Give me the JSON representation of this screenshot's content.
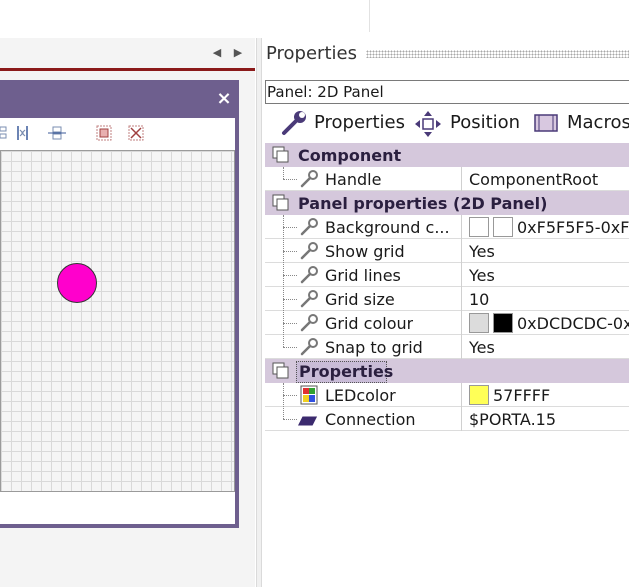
{
  "colors": {
    "window_purple": "#6e5f8e",
    "category_bg": "#d5c8dc",
    "led": "#ff00cc",
    "accent_red": "#8b1a1a"
  },
  "icons": {
    "tab_nav": [
      "chevron-left-icon",
      "chevron-right-icon"
    ],
    "toolbar": [
      "align-icon",
      "distribute-icon",
      "group-icon",
      "select-all-icon",
      "ungroup-icon"
    ],
    "property": "wrench-icon",
    "category": "copy-stack-icon"
  },
  "panel_window": {
    "close_glyph": "×"
  },
  "properties_panel": {
    "title": "Properties",
    "selector_value": "Panel: 2D Panel",
    "subtabs": [
      {
        "label": "Properties"
      },
      {
        "label": "Position"
      },
      {
        "label": "Macros"
      }
    ],
    "categories": [
      {
        "title": "Component",
        "rows": [
          {
            "label": "Handle",
            "value": "ComponentRoot"
          }
        ]
      },
      {
        "title": "Panel properties (2D Panel)",
        "rows": [
          {
            "label": "Background c...",
            "value": "0xF5F5F5-0xF",
            "swatch1": "#f5f5f5",
            "swatch2": "#ffffff"
          },
          {
            "label": "Show grid",
            "value": "Yes"
          },
          {
            "label": "Grid lines",
            "value": "Yes"
          },
          {
            "label": "Grid size",
            "value": "10"
          },
          {
            "label": "Grid colour",
            "value": "0xDCDCDC-0x",
            "swatch1": "#dcdcdc",
            "swatch2": "#000000"
          },
          {
            "label": "Snap to grid",
            "value": "Yes"
          }
        ]
      },
      {
        "title": "Properties",
        "rows": [
          {
            "label": "LEDcolor",
            "value": "57FFFF",
            "swatch1": "#ffff57"
          },
          {
            "label": "Connection",
            "value": "$PORTA.15"
          }
        ]
      }
    ]
  }
}
